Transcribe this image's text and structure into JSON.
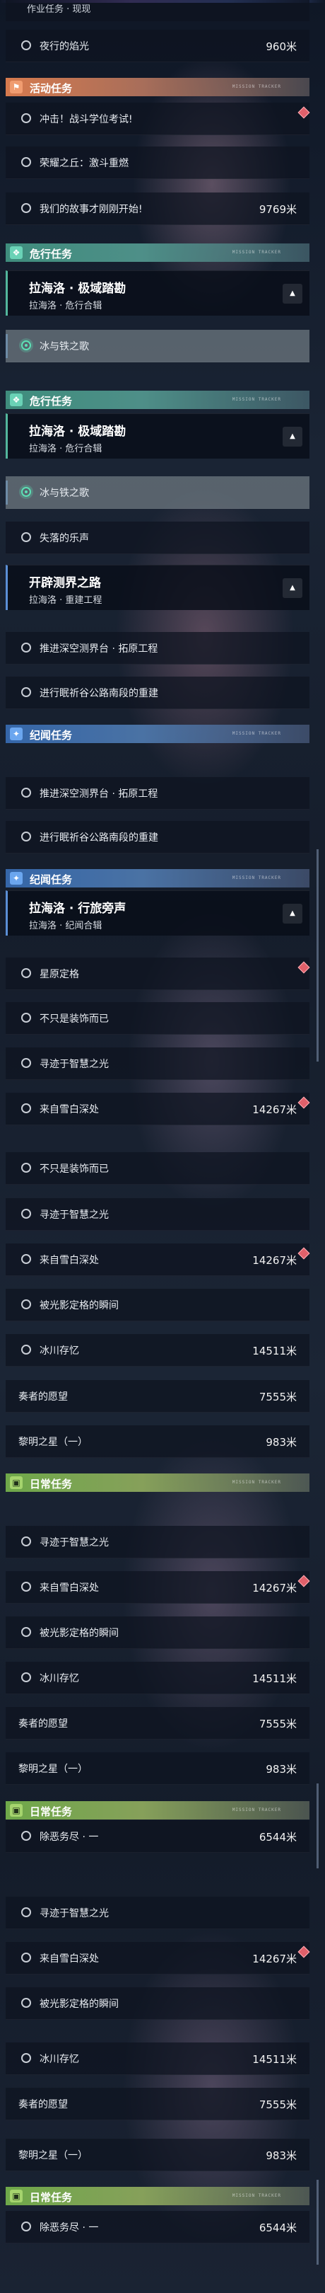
{
  "panel1": {
    "cut_title": "作业任务 · 现现",
    "row_a": {
      "label": "夜行的焰光",
      "dist": "960米"
    },
    "header": {
      "icon": "activity-icon",
      "title": "活动任务"
    },
    "rows": [
      {
        "label": "冲击！战斗学位考试!",
        "dist": ""
      },
      {
        "label": "荣耀之丘：激斗重燃",
        "dist": ""
      },
      {
        "label": "我们的故事才刚刚开始!",
        "dist": "9769米"
      }
    ],
    "header2": {
      "icon": "danger-icon",
      "title": "危行任务"
    },
    "mission": {
      "title": "拉海洛 · 极域踏勘",
      "sub": "拉海洛 · 危行合辑"
    },
    "sub_row": {
      "label": "冰与铁之歌"
    }
  },
  "panel2": {
    "header": {
      "icon": "danger-icon",
      "title": "危行任务"
    },
    "mission1": {
      "title": "拉海洛 · 极域踏勘",
      "sub": "拉海洛 · 危行合辑"
    },
    "rows1": [
      {
        "label": "冰与铁之歌",
        "dist": ""
      },
      {
        "label": "失落的乐声",
        "dist": ""
      }
    ],
    "mission2": {
      "title": "开辟测界之路",
      "sub": "拉海洛 · 重建工程"
    },
    "rows2": [
      {
        "label": "推进深空测界台 · 拓原工程",
        "dist": ""
      },
      {
        "label": "进行眠祈谷公路南段的重建",
        "dist": ""
      }
    ],
    "header2": {
      "icon": "chronicle-icon",
      "title": "纪闻任务"
    }
  },
  "panel3": {
    "rows": [
      {
        "label": "推进深空测界台 · 拓原工程",
        "dist": ""
      },
      {
        "label": "进行眠祈谷公路南段的重建",
        "dist": ""
      }
    ]
  },
  "panel4": {
    "header": {
      "icon": "chronicle-icon",
      "title": "纪闻任务"
    },
    "mission": {
      "title": "拉海洛 · 行旅旁声",
      "sub": "拉海洛 · 纪闻合辑"
    },
    "rows": [
      {
        "label": "星原定格",
        "dist": ""
      },
      {
        "label": "不只是装饰而已",
        "dist": ""
      },
      {
        "label": "寻迹于智慧之光",
        "dist": ""
      },
      {
        "label": "来自雪白深处",
        "dist": "14267米"
      }
    ]
  },
  "panel5": {
    "rows": [
      {
        "label": "不只是装饰而已",
        "dist": ""
      },
      {
        "label": "寻迹于智慧之光",
        "dist": ""
      },
      {
        "label": "来自雪白深处",
        "dist": "14267米"
      },
      {
        "label": "被光影定格的瞬间",
        "dist": ""
      },
      {
        "label": "冰川存忆",
        "dist": "14511米"
      },
      {
        "label": "奏者的愿望",
        "dist": "7555米"
      },
      {
        "label": "黎明之星（一）",
        "dist": "983米"
      }
    ],
    "header": {
      "icon": "daily-icon",
      "title": "日常任务"
    }
  },
  "panel6": {
    "rows": [
      {
        "label": "寻迹于智慧之光",
        "dist": ""
      },
      {
        "label": "来自雪白深处",
        "dist": "14267米"
      },
      {
        "label": "被光影定格的瞬间",
        "dist": ""
      },
      {
        "label": "冰川存忆",
        "dist": "14511米"
      },
      {
        "label": "奏者的愿望",
        "dist": "7555米"
      },
      {
        "label": "黎明之星（一）",
        "dist": "983米"
      }
    ],
    "header": {
      "icon": "daily-icon",
      "title": "日常任务"
    },
    "daily_row": {
      "label": "除恶务尽 · 一",
      "dist": "6544米"
    }
  },
  "panel7": {
    "rows": [
      {
        "label": "寻迹于智慧之光",
        "dist": ""
      },
      {
        "label": "来自雪白深处",
        "dist": "14267米"
      },
      {
        "label": "被光影定格的瞬间",
        "dist": ""
      },
      {
        "label": "冰川存忆",
        "dist": "14511米"
      },
      {
        "label": "奏者的愿望",
        "dist": "7555米"
      },
      {
        "label": "黎明之星（一）",
        "dist": "983米"
      }
    ],
    "header": {
      "icon": "daily-icon",
      "title": "日常任务"
    },
    "daily_row": {
      "label": "除恶务尽 · 一",
      "dist": "6544米"
    }
  },
  "header_fine_text": "MISSION TRACKER",
  "colors": {
    "activity": "#d67a4e",
    "danger": "#3f8d7d",
    "chronicle": "#3566a8",
    "daily": "#6fa84a",
    "accent": "#5de0b5",
    "flag": "#e0606a"
  }
}
